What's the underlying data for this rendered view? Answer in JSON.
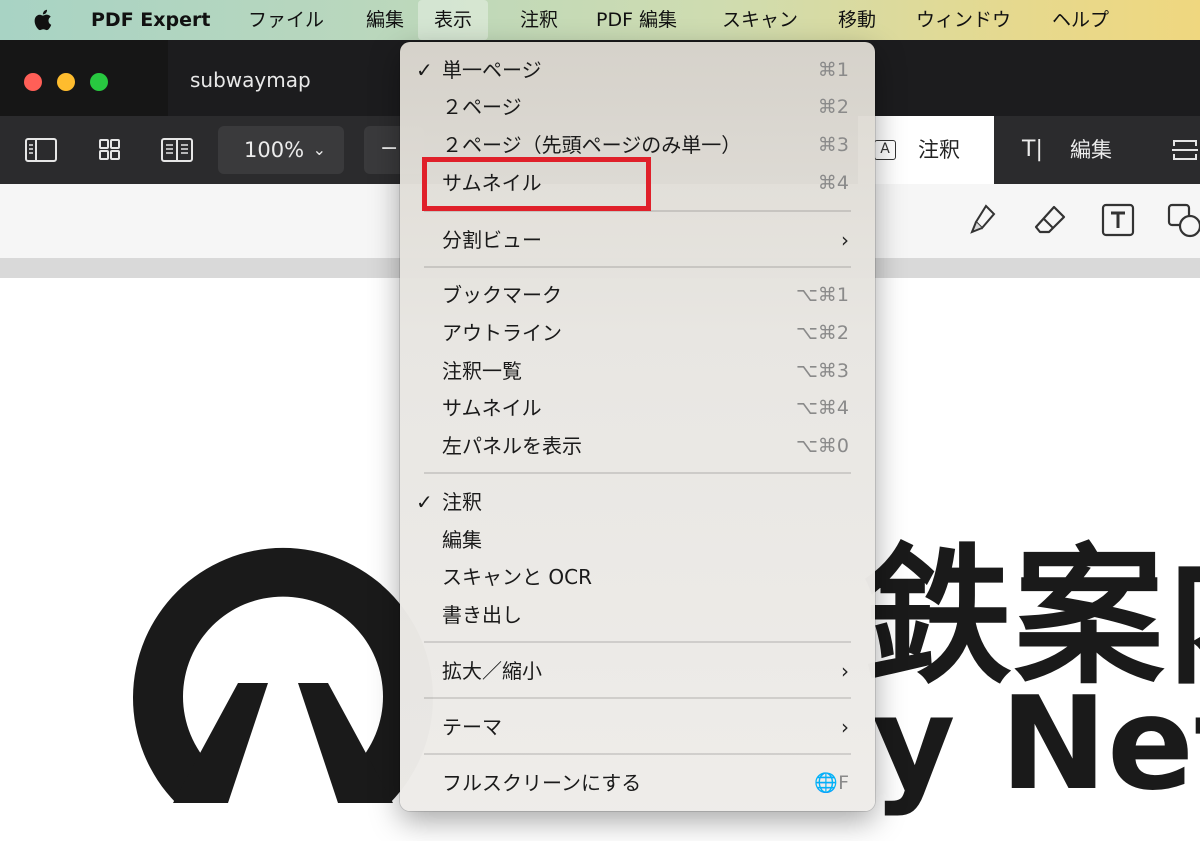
{
  "menubar": {
    "app_name": "PDF Expert",
    "items": [
      "ファイル",
      "編集",
      "表示",
      "注釈",
      "PDF 編集",
      "スキャン",
      "移動",
      "ウィンドウ",
      "ヘルプ"
    ],
    "active_item": "表示"
  },
  "window": {
    "tab_title": "subwaymap"
  },
  "toolbar": {
    "zoom_value": "100%",
    "zoom_minus": "−",
    "mode_annotate_label": "注釈",
    "mode_annotate_icon_text": "A",
    "mode_edit_label": "編集",
    "mode_edit_icon_text": "T|"
  },
  "view_menu": {
    "items": [
      {
        "label": "単一ページ",
        "shortcut": "⌘1",
        "checked": true
      },
      {
        "label": "２ページ",
        "shortcut": "⌘2"
      },
      {
        "label": "２ページ（先頭ページのみ単一）",
        "shortcut": "⌘3"
      },
      {
        "label": "サムネイル",
        "shortcut": "⌘4"
      },
      {
        "label": "分割ビュー",
        "submenu": true
      },
      {
        "label": "ブックマーク",
        "shortcut": "⌥⌘1"
      },
      {
        "label": "アウトライン",
        "shortcut": "⌥⌘2"
      },
      {
        "label": "注釈一覧",
        "shortcut": "⌥⌘3"
      },
      {
        "label": "サムネイル",
        "shortcut": "⌥⌘4"
      },
      {
        "label": "左パネルを表示",
        "shortcut": "⌥⌘0"
      },
      {
        "label": "注釈",
        "checked": true
      },
      {
        "label": "編集"
      },
      {
        "label": "スキャンと OCR"
      },
      {
        "label": "書き出し"
      },
      {
        "label": "拡大／縮小",
        "submenu": true
      },
      {
        "label": "テーマ",
        "submenu": true
      },
      {
        "label": "フルスクリーンにする",
        "shortcut": "🌐F"
      }
    ],
    "check_mark": "✓",
    "submenu_arrow": "›"
  },
  "document": {
    "text_jp": "鉄案内",
    "text_en": "y Netw"
  },
  "colors": {
    "highlight": "#e0202a",
    "close": "#ff5f57",
    "minimize": "#febc2e",
    "maximize": "#28c840"
  }
}
